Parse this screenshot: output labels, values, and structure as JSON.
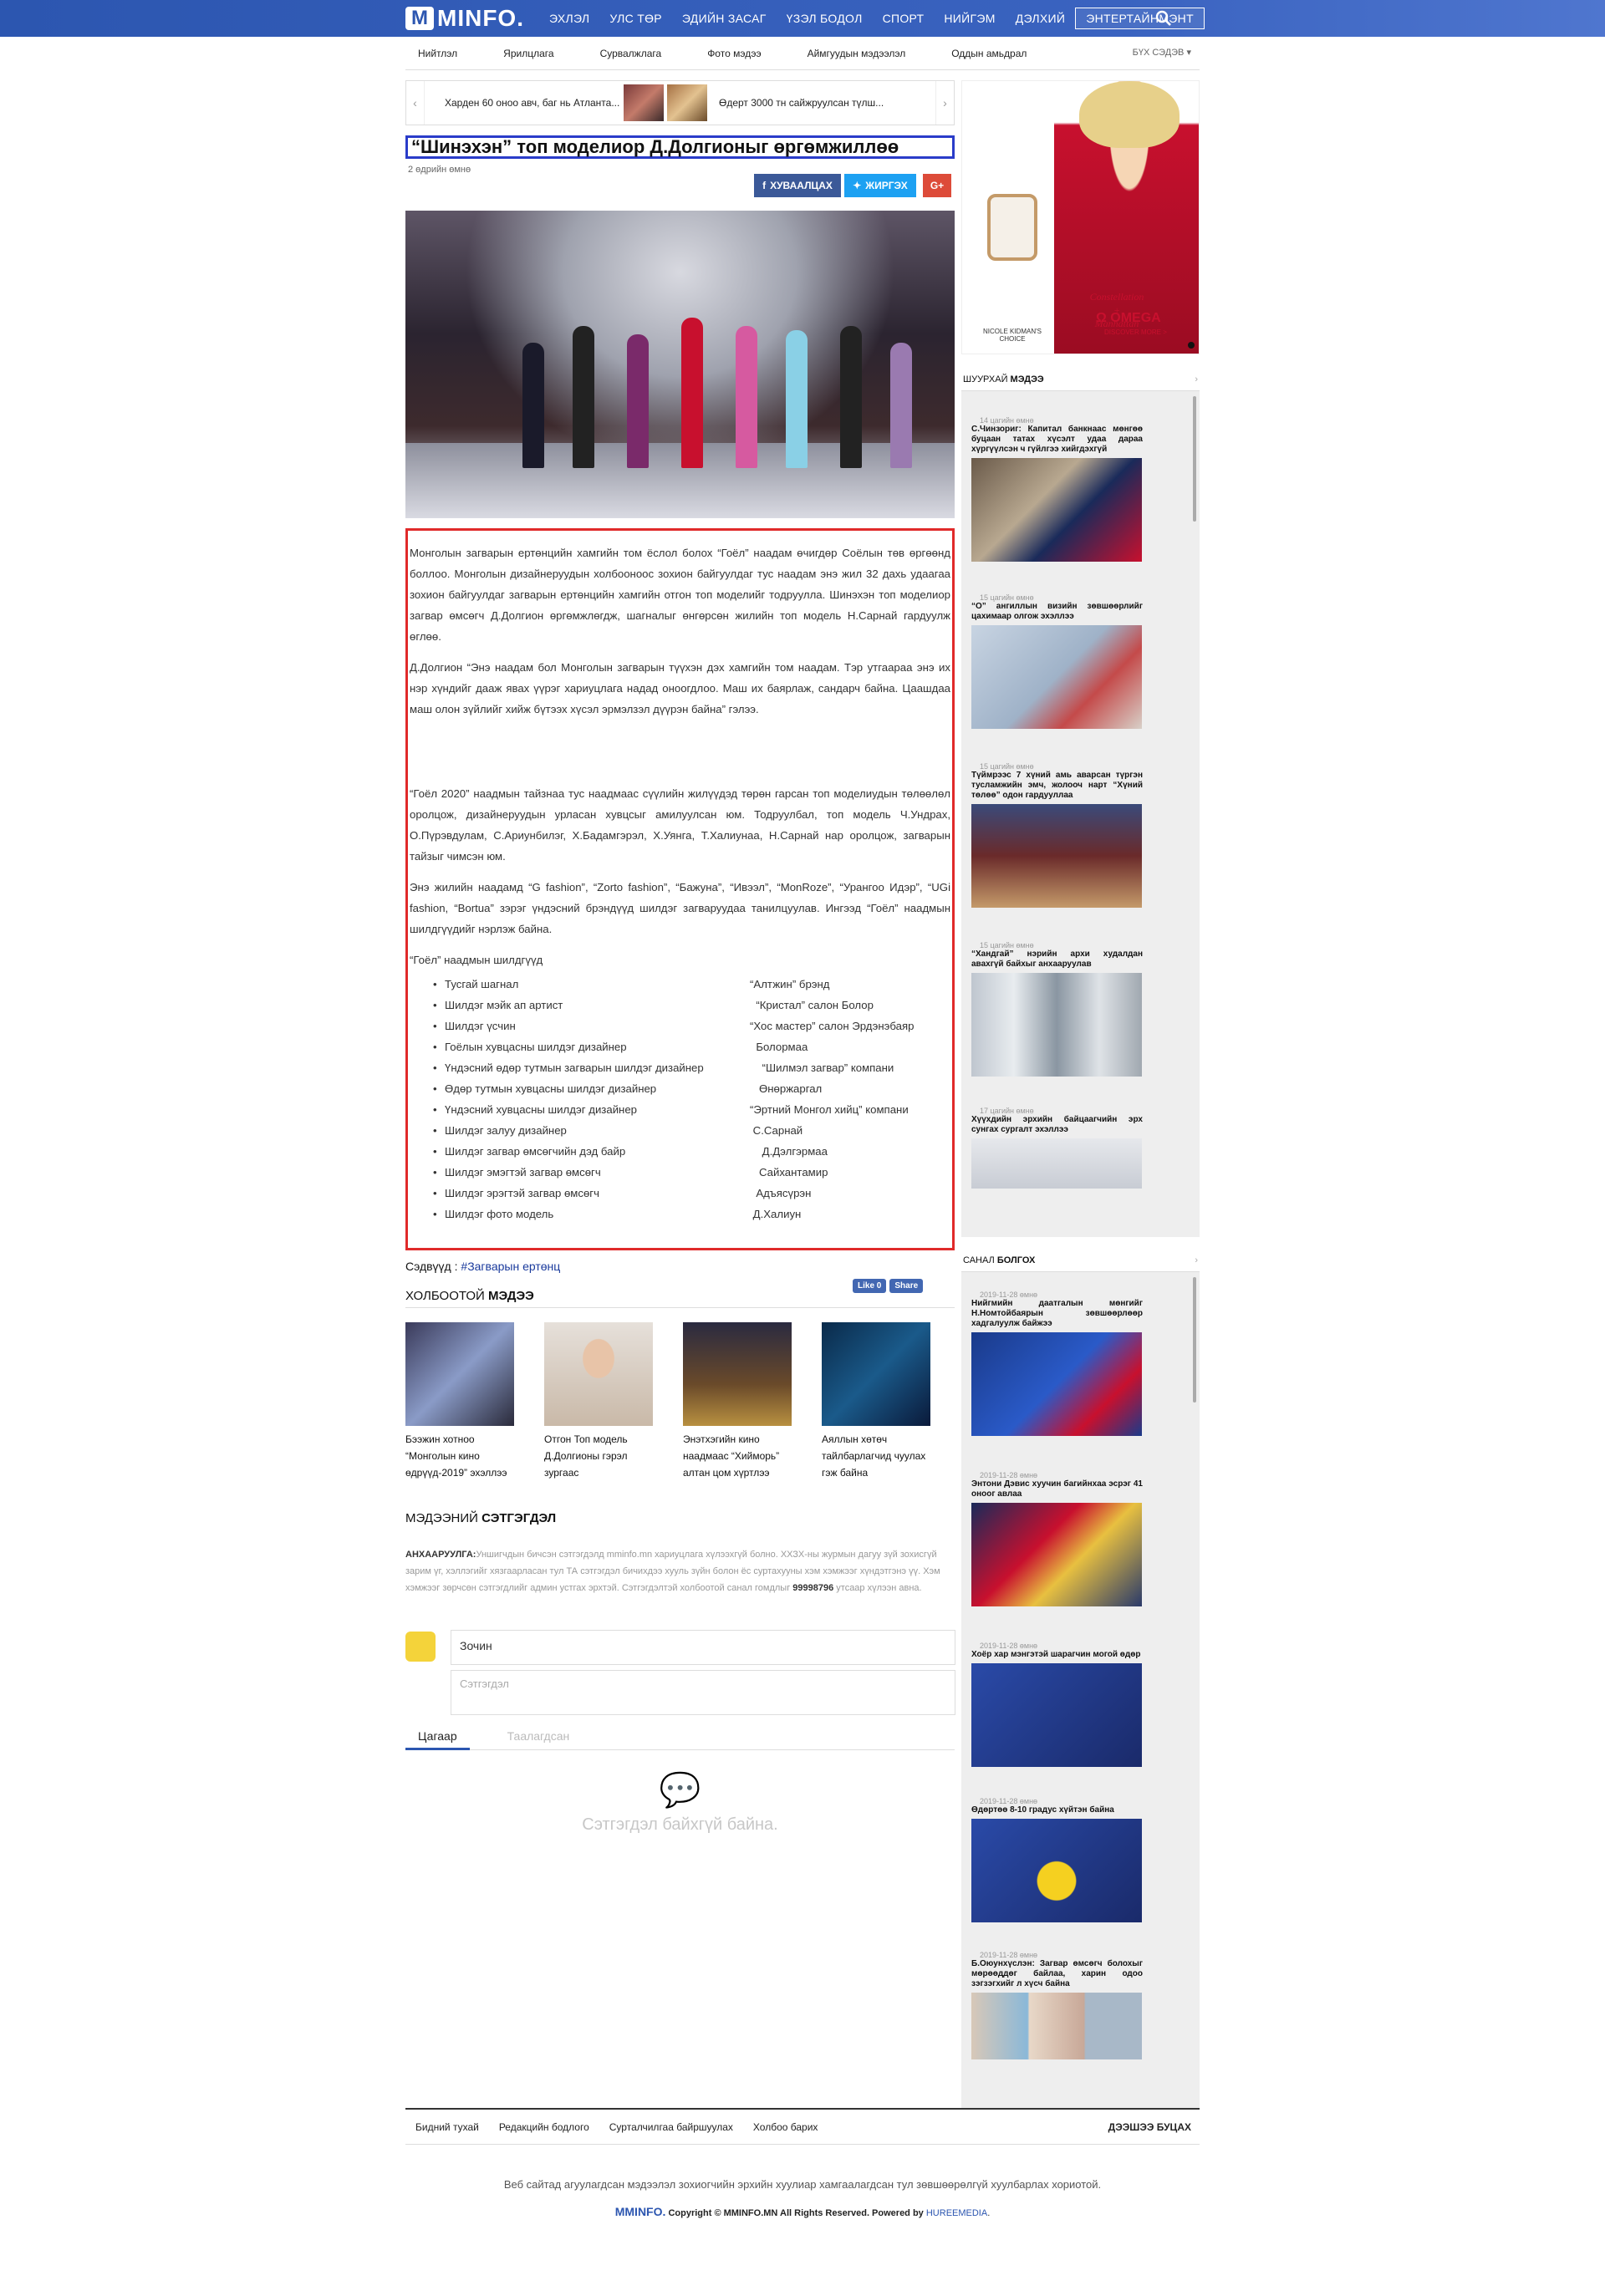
{
  "site": {
    "logo_text": "MINFO."
  },
  "nav": {
    "items": [
      "ЭХЛЭЛ",
      "УЛС ТӨР",
      "ЭДИЙН ЗАСАГ",
      "ҮЗЭЛ БОДОЛ",
      "СПОРТ",
      "НИЙГЭМ",
      "ДЭЛХИЙ",
      "ЭНТЕРТАЙНМЭНТ"
    ]
  },
  "subnav": {
    "items": [
      "Нийтлэл",
      "Ярилцлага",
      "Сурвалжлага",
      "Фото мэдээ",
      "Аймгуудын мэдээлэл",
      "Оддын амьдрал"
    ],
    "all": "БҮХ СЭДЭВ"
  },
  "strip": {
    "item1": "Харден 60 оноо авч, баг нь Атланта...",
    "item2": "Өдерт 3000 тн сайжруулсан түлш..."
  },
  "article": {
    "title": "“Шинэхэн” топ моделиор Д.Долгионыг өргөмжиллөө",
    "date": "2 өдрийн өмнө",
    "share_fb": "ХУВААЛЦАХ",
    "share_tw": "ЖИРГЭХ",
    "share_gp": "G+",
    "p1": "Монголын загварын ертөнцийн хамгийн том ёслол болох “Гоёл” наадам өчигдөр Соёлын төв өргөөнд боллоо. Монголын дизайнеруудын холбооноос зохион байгуулдаг тус наадам энэ жил 32 дахь удаагаа зохион байгуулдаг загварын ертөнцийн хамгийн отгон топ моделийг тодруулла. Шинэхэн топ моделиор загвар өмсөгч Д.Долгион өргөмжлөгдж, шагналыг өнгөрсөн жилийн топ модель Н.Сарнай гардуулж өглөө.",
    "p2": "Д.Долгион “Энэ наадам бол Монголын загварын түүхэн дэх хамгийн том наадам. Тэр утгаараа энэ их нэр хүндийг дааж явах үүрэг хариуцлага надад оноогдлоо. Маш их баярлаж, сандарч байна. Цаашдаа маш олон зүйлийг хийж бүтээх хүсэл эрмэлзэл дүүрэн байна” гэлээ.",
    "p3": "“Гоёл 2020” наадмын тайзнаа тус наадмаас сүүлийн жилүүдэд төрөн гарсан топ моделиудын төлөөлөл оролцож, дизайнеруудын урласан хувцсыг амилуулсан юм. Тодруулбал, топ модель Ч.Ундрах, О.Пүрэвдулам, С.Ариунбилэг, Х.Бадамгэрэл, Х.Уянга, Т.Халиунаа, Н.Сарнай нар оролцож, загварын тайзыг чимсэн юм.",
    "p4": "Энэ жилийн наадамд “G fashion”, “Zorto fashion”, “Бажуна”, “Ивээл”, “MonRoze”, “Урангоо Идэр”, “UGi fashion, “Bortua” зэрэг үндэсний брэндүүд  шилдэг загваруудаа танилцуулав. Ингээд “Гоёл” наадмын шилдгүүдийг нэрлэж байна.",
    "p5": "“Гоёл” наадмын шилдгүүд",
    "winners": [
      {
        "award": "Тусгай шагнал",
        "winner": "“Алтжин” брэнд"
      },
      {
        "award": "Шилдэг мэйк ап артист",
        "winner": "  “Кристал” салон Болор"
      },
      {
        "award": "Шилдэг үсчин",
        "winner": "“Хос мастер” салон Эрдэнэбаяр"
      },
      {
        "award": "Гоёлын хувцасны шилдэг дизайнер",
        "winner": "  Болормаа"
      },
      {
        "award": "Үндэсний өдөр тутмын загварын шилдэг дизайнер",
        "winner": "    “Шилмэл загвар” компани"
      },
      {
        "award": "Өдөр тутмын хувцасны шилдэг дизайнер",
        "winner": "   Өнөржаргал"
      },
      {
        "award": "Үндэсний хувцасны шилдэг дизайнер",
        "winner": "“Эртний Монгол хийц” компани"
      },
      {
        "award": "Шилдэг залуу дизайнер",
        "winner": " С.Сарнай"
      },
      {
        "award": "Шилдэг загвар өмсөгчийн дэд байр",
        "winner": "    Д.Дэлгэрмаа"
      },
      {
        "award": "Шилдэг эмэгтэй загвар өмсөгч",
        "winner": "   Сайхантамир"
      },
      {
        "award": "Шилдэг эрэгтэй загвар өмсөгч",
        "winner": "  Адъясүрэн"
      },
      {
        "award": "Шилдэг фото модель",
        "winner": " Д.Халиун"
      }
    ],
    "tags_label": "Сэдвүүд :",
    "tag": "#Загварын ертөнц"
  },
  "related": {
    "head_a": "ХОЛБООТОЙ ",
    "head_b": "МЭДЭЭ",
    "like": "Like 0",
    "share": "Share",
    "items": [
      {
        "caption": "Бээжин хотноо “Монголын кино өдрүүд-2019” эхэллээ"
      },
      {
        "caption": "Отгон Топ модель Д.Долгионы гэрэл зургаас"
      },
      {
        "caption": "Энэтхэгийн кино наадмаас “Хийморь” алтан цом хүртлээ"
      },
      {
        "caption": "Аяллын хөтөч тайлбарлагчид чуулах гэж байна"
      }
    ]
  },
  "comments": {
    "head_a": "МЭДЭЭНИЙ ",
    "head_b": "СЭТГЭГДЭЛ",
    "notice_label": "АНХААРУУЛГА:",
    "notice": "Уншигчдын бичсэн сэтгэгдэлд mminfo.mn хариуцлага хүлээхгүй болно. ХХЗХ-ны журмын дагуу зүй зохисгүй зарим үг, хэллэгийг хязгаарласан тул ТА сэтгэгдэл бичихдээ хууль зүйн болон ёс суртахууны хэм хэмжээг хүндэтгэнэ үү. Хэм хэмжээг зөрчсөн сэтгэгдлийг админ устгах эрхтэй. Сэтгэгдэлтэй холбоотой санал гомдлыг ",
    "phone": "99998796",
    "notice_end": " утсаар хүлээн авна.",
    "name_value": "Зочин",
    "comment_placeholder": "Сэтгэгдэл",
    "tab_latest": "Цагаар",
    "tab_liked": "Таалагдсан",
    "empty": "Сэтгэгдэл байхгүй байна."
  },
  "ad": {
    "brand": "Constellation\n+\nManhattan",
    "omega": "Ω OMEGA",
    "discover": "DISCOVER MORE >",
    "choice": "NICOLE KIDMAN'S CHOICE"
  },
  "sidebar1": {
    "head_a": "ШУУРХАЙ ",
    "head_b": "МЭДЭЭ",
    "items": [
      {
        "time": "14 цагийн өмнө",
        "title": "С.Чинзориг: Капитал банкнаас мөнгөө буцаан татах хүсэлт удаа дараа хүргүүлсэн ч гүйлгээ хийгдэхгүй"
      },
      {
        "time": "15 цагийн өмнө",
        "title": "“О” ангиллын визийн зөвшөөрлийг цахимаар олгож эхэллээ"
      },
      {
        "time": "15 цагийн өмнө",
        "title": "Түймрээс 7 хүний амь аварсан түргэн тусламжийн эмч, жолооч нарт “Хүний төлөө” одон гардууллаа"
      },
      {
        "time": "15 цагийн өмнө",
        "title": "“Хандгай” нэрийн архи худалдан авахгүй байхыг анхааруулав"
      },
      {
        "time": "17 цагийн өмнө",
        "title": "Хүүхдийн эрхийн байцаагчийн эрх сунгах сургалт эхэллээ"
      }
    ]
  },
  "sidebar2": {
    "head_a": "САНАЛ ",
    "head_b": "БОЛГОХ",
    "items": [
      {
        "time": "2019-11-28 өмнө",
        "title": "Нийгмийн даатгалын мөнгийг Н.Номтойбаярын зөвшөөрлөөр хадгалуулж байжээ"
      },
      {
        "time": "2019-11-28 өмнө",
        "title": "Энтони Дэвис хуучин багийнхаа эсрэг 41 оноог авлаа"
      },
      {
        "time": "2019-11-28 өмнө",
        "title": "Хоёр хар мэнгэтэй шарагчин могой өдөр"
      },
      {
        "time": "2019-11-28 өмнө",
        "title": "Өдөртөө 8-10 градус хүйтэн байна"
      },
      {
        "time": "2019-11-28 өмнө",
        "title": "Б.Оюунхүслэн: Загвар өмсөгч болохыг мөрөөддөг байлаа, харин одоо зэгзэгхийг л хүсч байна"
      }
    ]
  },
  "footer": {
    "links": [
      "Бидний тухай",
      "Редакцийн бодлого",
      "Сурталчилгаа байршуулах",
      "Холбоо барих"
    ],
    "back": "ДЭЭШЭЭ БУЦАХ",
    "note": "Веб сайтад агуулагдсан мэдээлэл зохиогчийн эрхийн хуулиар хамгаалагдсан тул зөвшөөрөлгүй хуулбарлах хориотой.",
    "copy": "Copyright © MMINFO.MN All Rights Reserved. Powered by ",
    "powered": "HUREEMEDIA",
    "logo_small": "MMINFO."
  }
}
